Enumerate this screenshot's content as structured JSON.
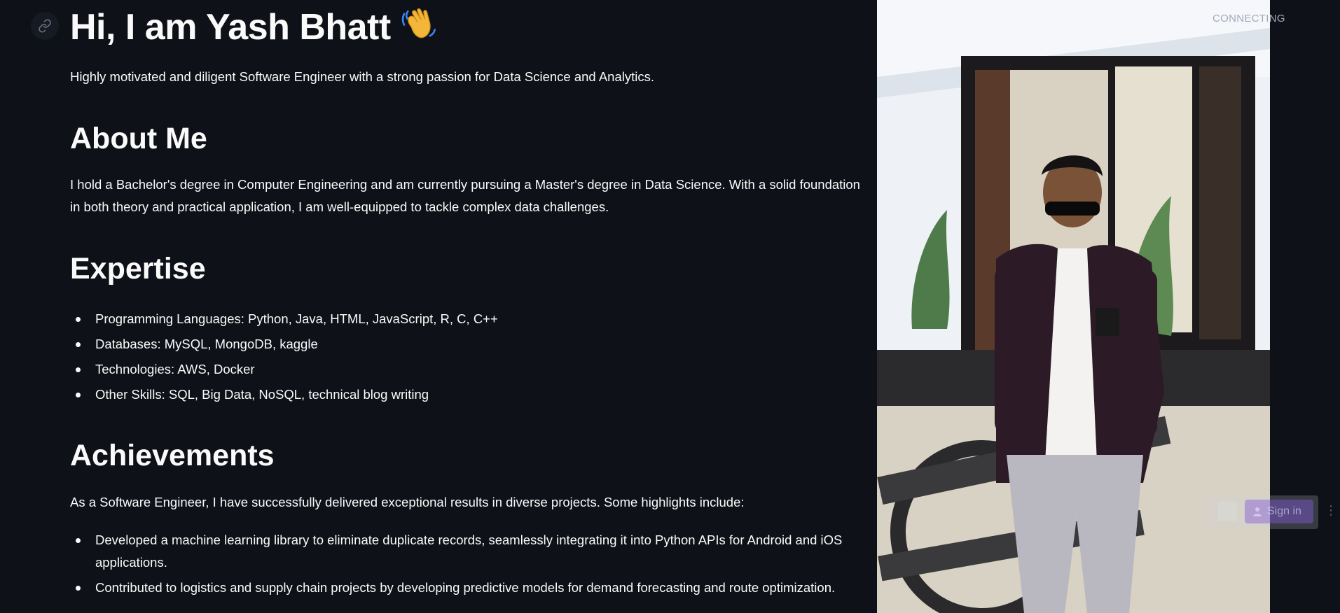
{
  "hero": {
    "title": "Hi, I am Yash Bhatt",
    "emoji": "👋",
    "subtitle": "Highly motivated and diligent Software Engineer with a strong passion for Data Science and Analytics."
  },
  "about": {
    "heading": "About Me",
    "text": "I hold a Bachelor's degree in Computer Engineering and am currently pursuing a Master's degree in Data Science. With a solid foundation in both theory and practical application, I am well-equipped to tackle complex data challenges."
  },
  "expertise": {
    "heading": "Expertise",
    "items": [
      "Programming Languages: Python, Java, HTML, JavaScript, R, C, C++",
      "Databases: MySQL, MongoDB, kaggle",
      "Technologies: AWS, Docker",
      "Other Skills: SQL, Big Data, NoSQL, technical blog writing"
    ]
  },
  "achievements": {
    "heading": "Achievements",
    "intro": "As a Software Engineer, I have successfully delivered exceptional results in diverse projects. Some highlights include:",
    "items": [
      "Developed a machine learning library to eliminate duplicate records, seamlessly integrating it into Python APIs for Android and iOS applications.",
      "Contributed to logistics and supply chain projects by developing predictive models for demand forecasting and route optimization."
    ]
  },
  "status": {
    "text": "CONNECTING"
  },
  "signin": {
    "label": "Sign in"
  },
  "icons": {
    "link": "link-icon",
    "wave": "waving-hand-icon",
    "user": "user-icon",
    "grip": "grip-icon"
  },
  "colors": {
    "background": "#0e1117",
    "text": "#fafafa",
    "status": "#a3a8b8",
    "signin": "#825adc"
  }
}
